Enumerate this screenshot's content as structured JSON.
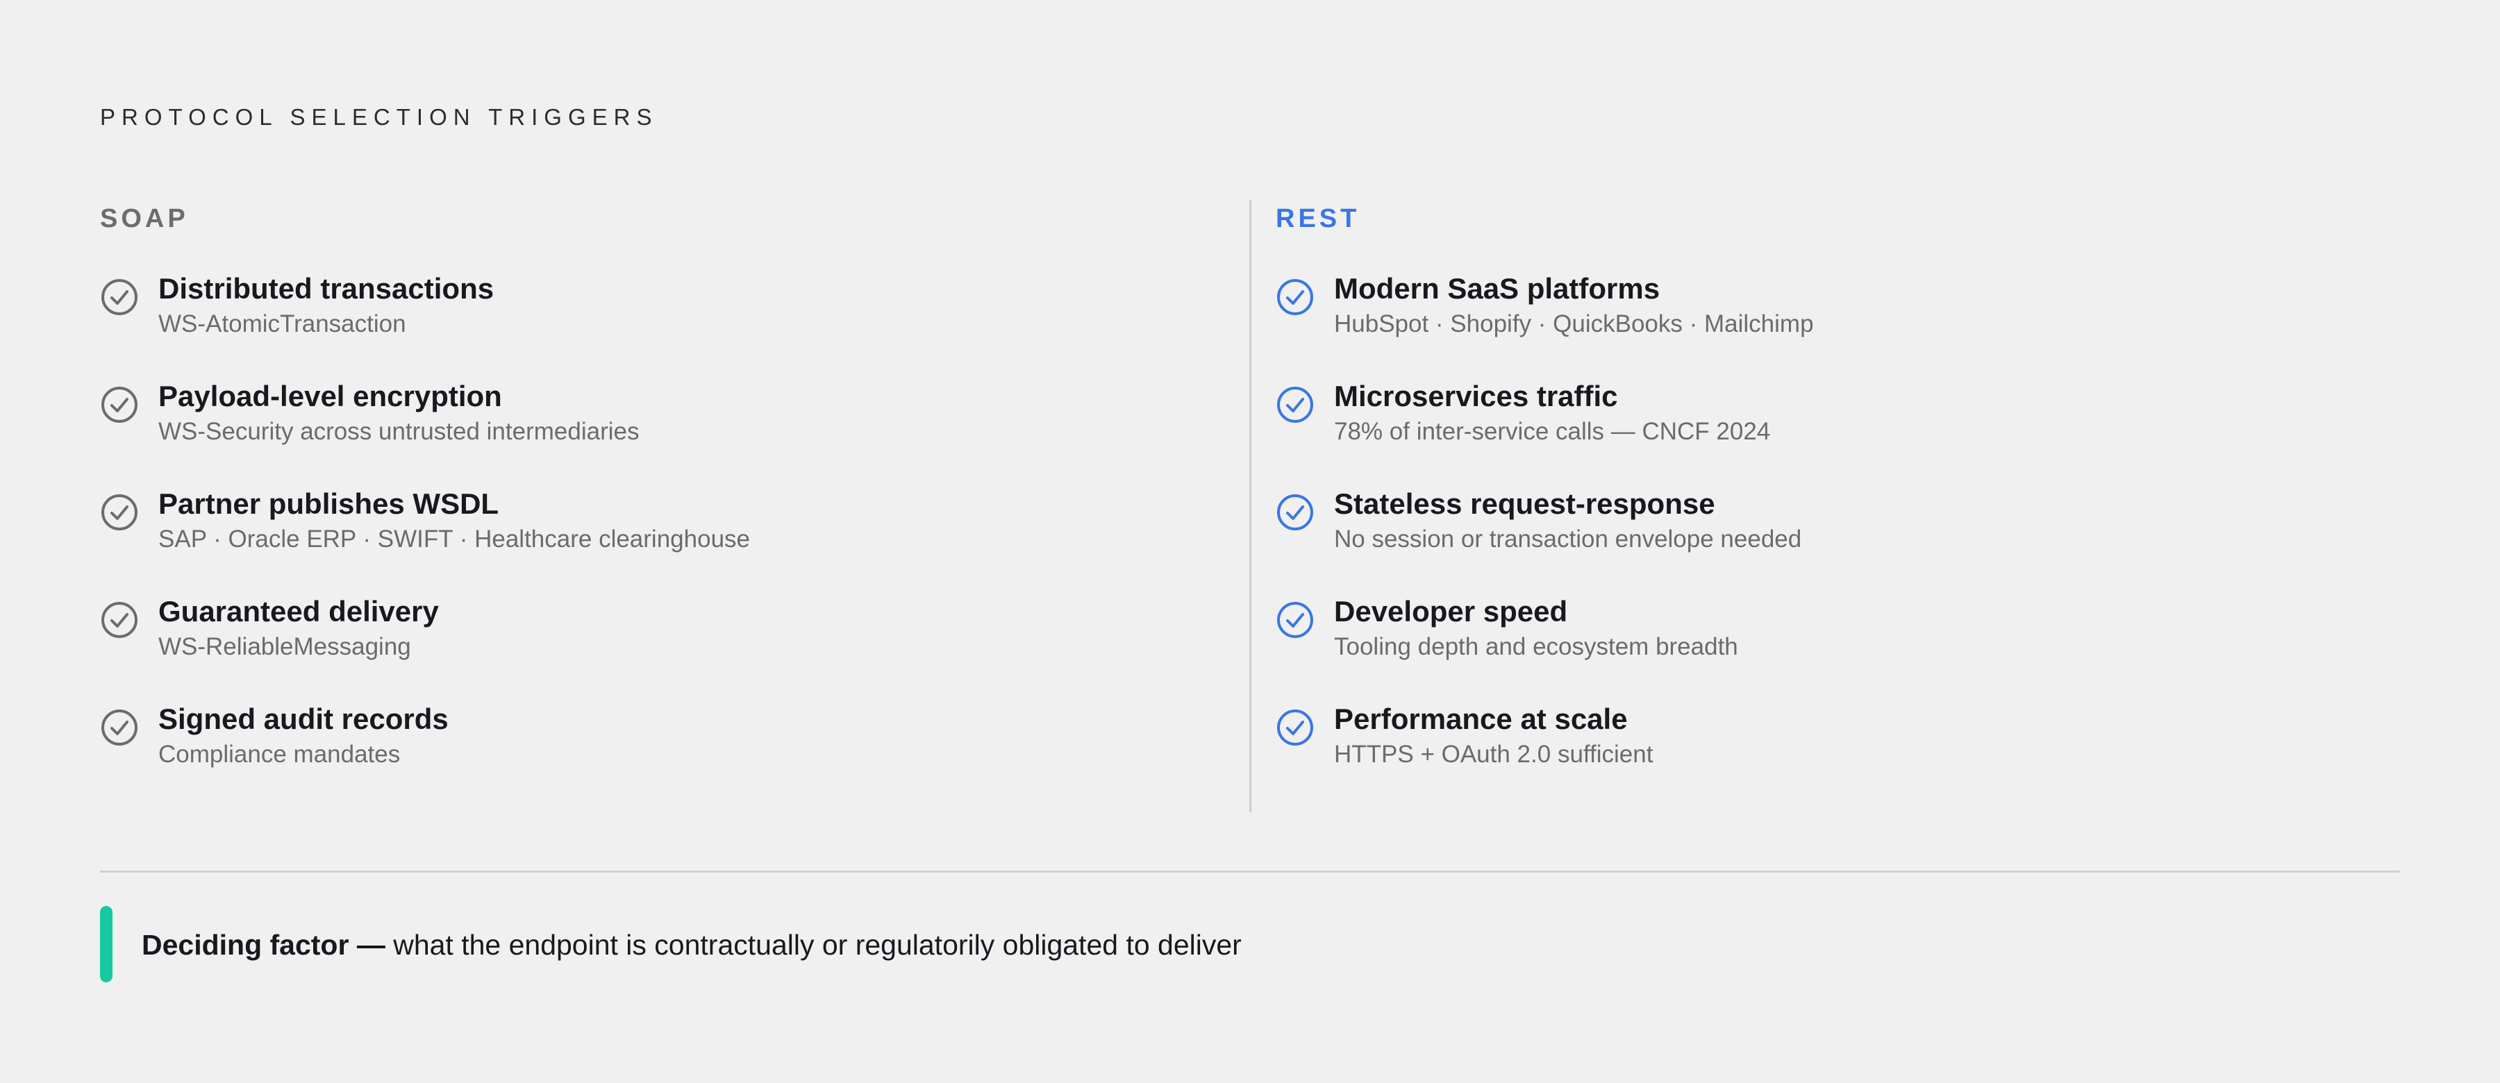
{
  "eyebrow": "PROTOCOL SELECTION TRIGGERS",
  "colors": {
    "soap": "#6a6c70",
    "rest": "#3a76e3",
    "accent": "#17c9a0"
  },
  "soap": {
    "heading": "SOAP",
    "items": [
      {
        "icon": "check-circle-icon",
        "title": "Distributed transactions",
        "sub": "WS-AtomicTransaction"
      },
      {
        "icon": "check-circle-icon",
        "title": "Payload-level encryption",
        "sub": "WS-Security across untrusted intermediaries"
      },
      {
        "icon": "check-circle-icon",
        "title": "Partner publishes WSDL",
        "sub": "SAP · Oracle ERP · SWIFT · Healthcare clearinghouse"
      },
      {
        "icon": "check-circle-icon",
        "title": "Guaranteed delivery",
        "sub": "WS-ReliableMessaging"
      },
      {
        "icon": "check-circle-icon",
        "title": "Signed audit records",
        "sub": "Compliance mandates"
      }
    ]
  },
  "rest": {
    "heading": "REST",
    "items": [
      {
        "icon": "check-circle-icon",
        "title": "Modern SaaS platforms",
        "sub": "HubSpot · Shopify · QuickBooks · Mailchimp"
      },
      {
        "icon": "check-circle-icon",
        "title": "Microservices traffic",
        "sub": "78% of inter-service calls — CNCF 2024"
      },
      {
        "icon": "check-circle-icon",
        "title": "Stateless request-response",
        "sub": "No session or transaction envelope needed"
      },
      {
        "icon": "check-circle-icon",
        "title": "Developer speed",
        "sub": "Tooling depth and ecosystem breadth"
      },
      {
        "icon": "check-circle-icon",
        "title": "Performance at scale",
        "sub": "HTTPS + OAuth 2.0 sufficient"
      }
    ]
  },
  "footer": {
    "label": "Deciding factor —",
    "text": " what the endpoint is contractually or regulatorily obligated to deliver"
  }
}
